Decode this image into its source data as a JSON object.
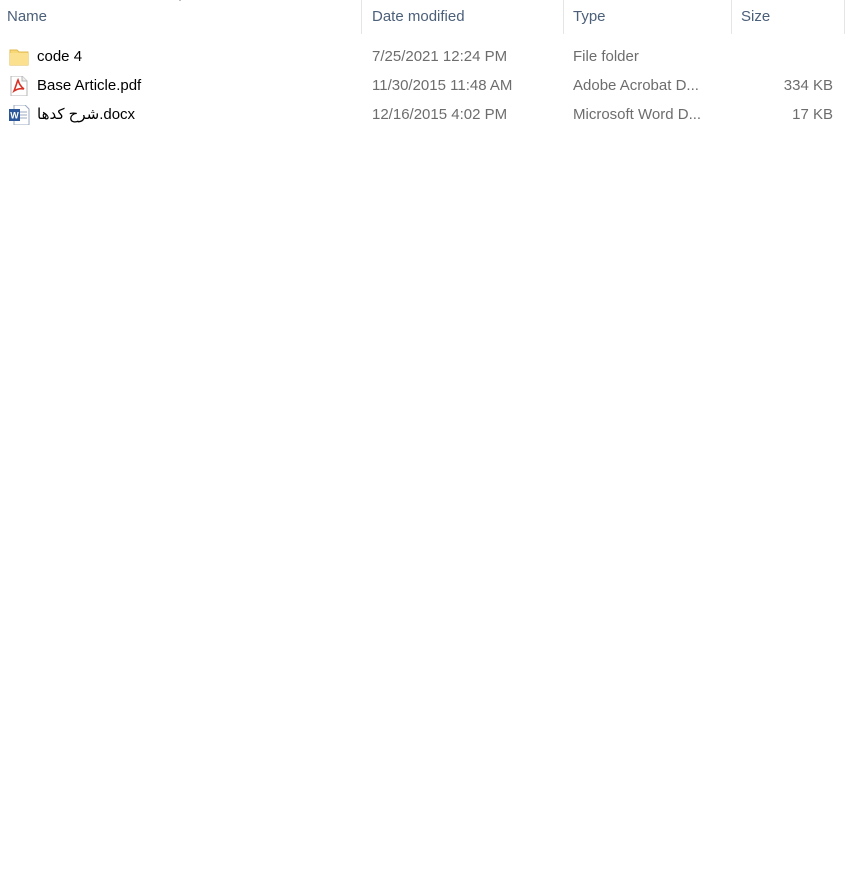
{
  "columns": {
    "name": "Name",
    "date_modified": "Date modified",
    "type": "Type",
    "size": "Size"
  },
  "sort": {
    "column": "Name",
    "icon": "sort-arrow-icon"
  },
  "files": [
    {
      "name": "code 4",
      "date": "7/25/2021 12:24 PM",
      "type": "File folder",
      "size": "",
      "icon": "folder-icon"
    },
    {
      "name": "Base Article.pdf",
      "date": "11/30/2015 11:48 AM",
      "type": "Adobe Acrobat D...",
      "size": "334 KB",
      "icon": "pdf-file-icon"
    },
    {
      "name": "شرح کدها.docx",
      "date": "12/16/2015 4:02 PM",
      "type": "Microsoft Word D...",
      "size": "17 KB",
      "icon": "word-file-icon"
    }
  ],
  "colors": {
    "header_text": "#4c607a",
    "detail_text": "#6d6d6d",
    "folder_yellow": "#f8d775",
    "pdf_red": "#d93025",
    "word_blue": "#2b579a"
  }
}
